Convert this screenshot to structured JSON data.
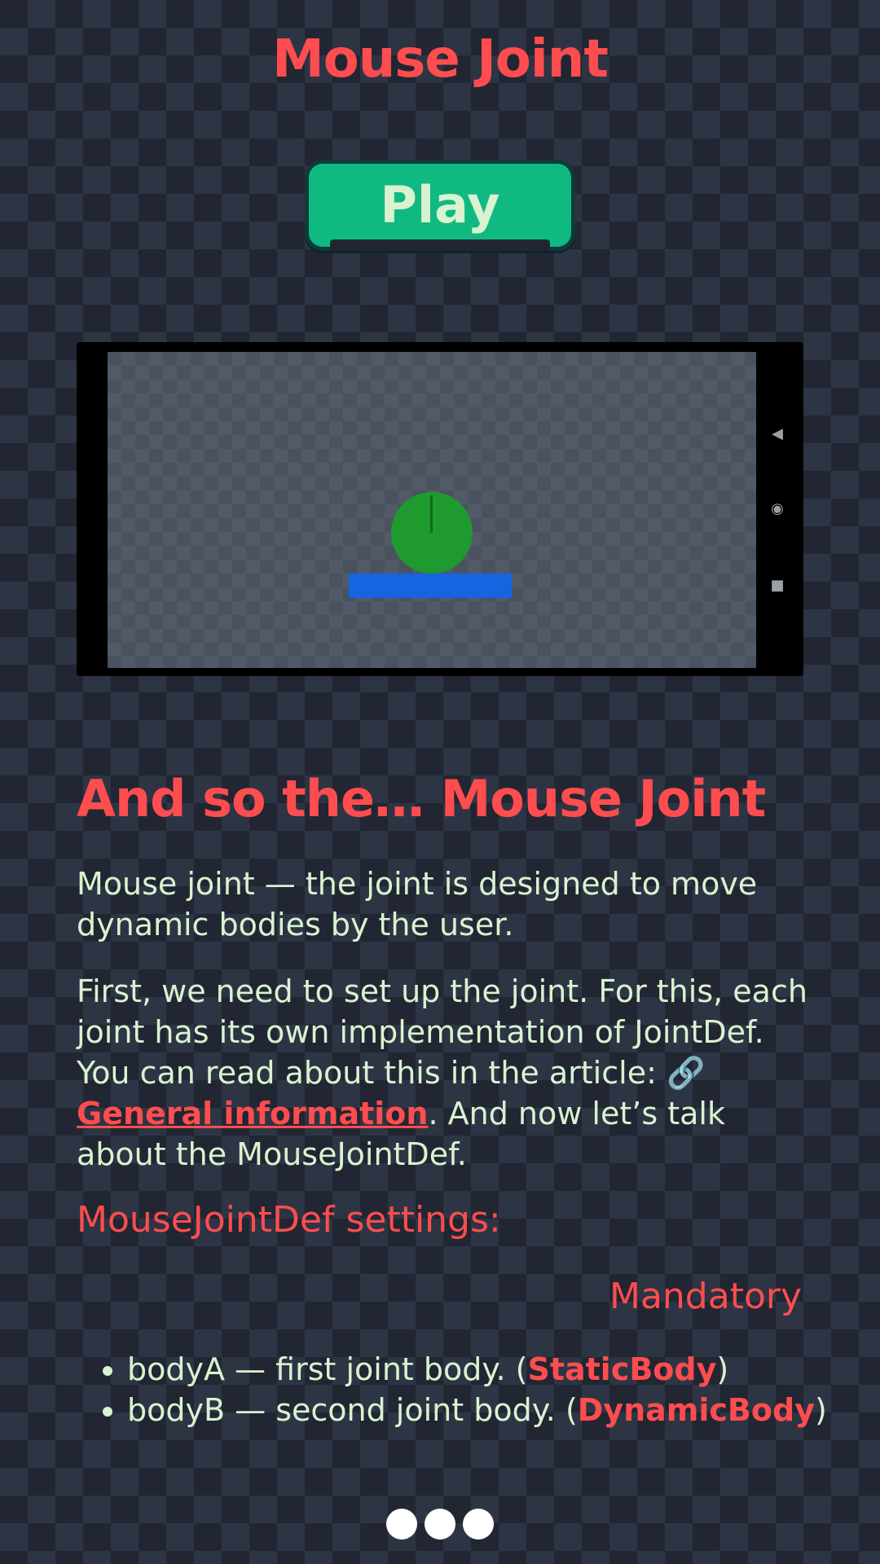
{
  "header": {
    "title": "Mouse Joint"
  },
  "play_button": {
    "label": "Play"
  },
  "phone": {
    "nav": {
      "back": "◀",
      "home": "◉",
      "recents": "■"
    },
    "colors": {
      "ball": "#1f9a2e",
      "platform": "#1565e0"
    }
  },
  "article": {
    "heading": "And so the… Mouse Joint",
    "intro": "Mouse joint — the joint is designed to move dynamic bodies by the user.",
    "para2_before": "First, we need to set up the joint. For this, each joint has its own implementation of JointDef. You can read about this in the article: ",
    "link_icon": "🔗",
    "link_text": "General information",
    "para2_after": ". And now let’s talk about the MouseJointDef.",
    "settings_title": "MouseJointDef settings:",
    "mandatory_label": "Mandatory",
    "settings": [
      {
        "text": "bodyA — first joint body. (",
        "type": "StaticBody",
        "close": ")"
      },
      {
        "text": "bodyB — second joint body. (",
        "type": "DynamicBody",
        "close": ")"
      }
    ]
  },
  "pagination": {
    "dots": 3
  },
  "colors": {
    "accent": "#ff4d4f",
    "text": "#d9f2d0",
    "button": "#10b981"
  }
}
